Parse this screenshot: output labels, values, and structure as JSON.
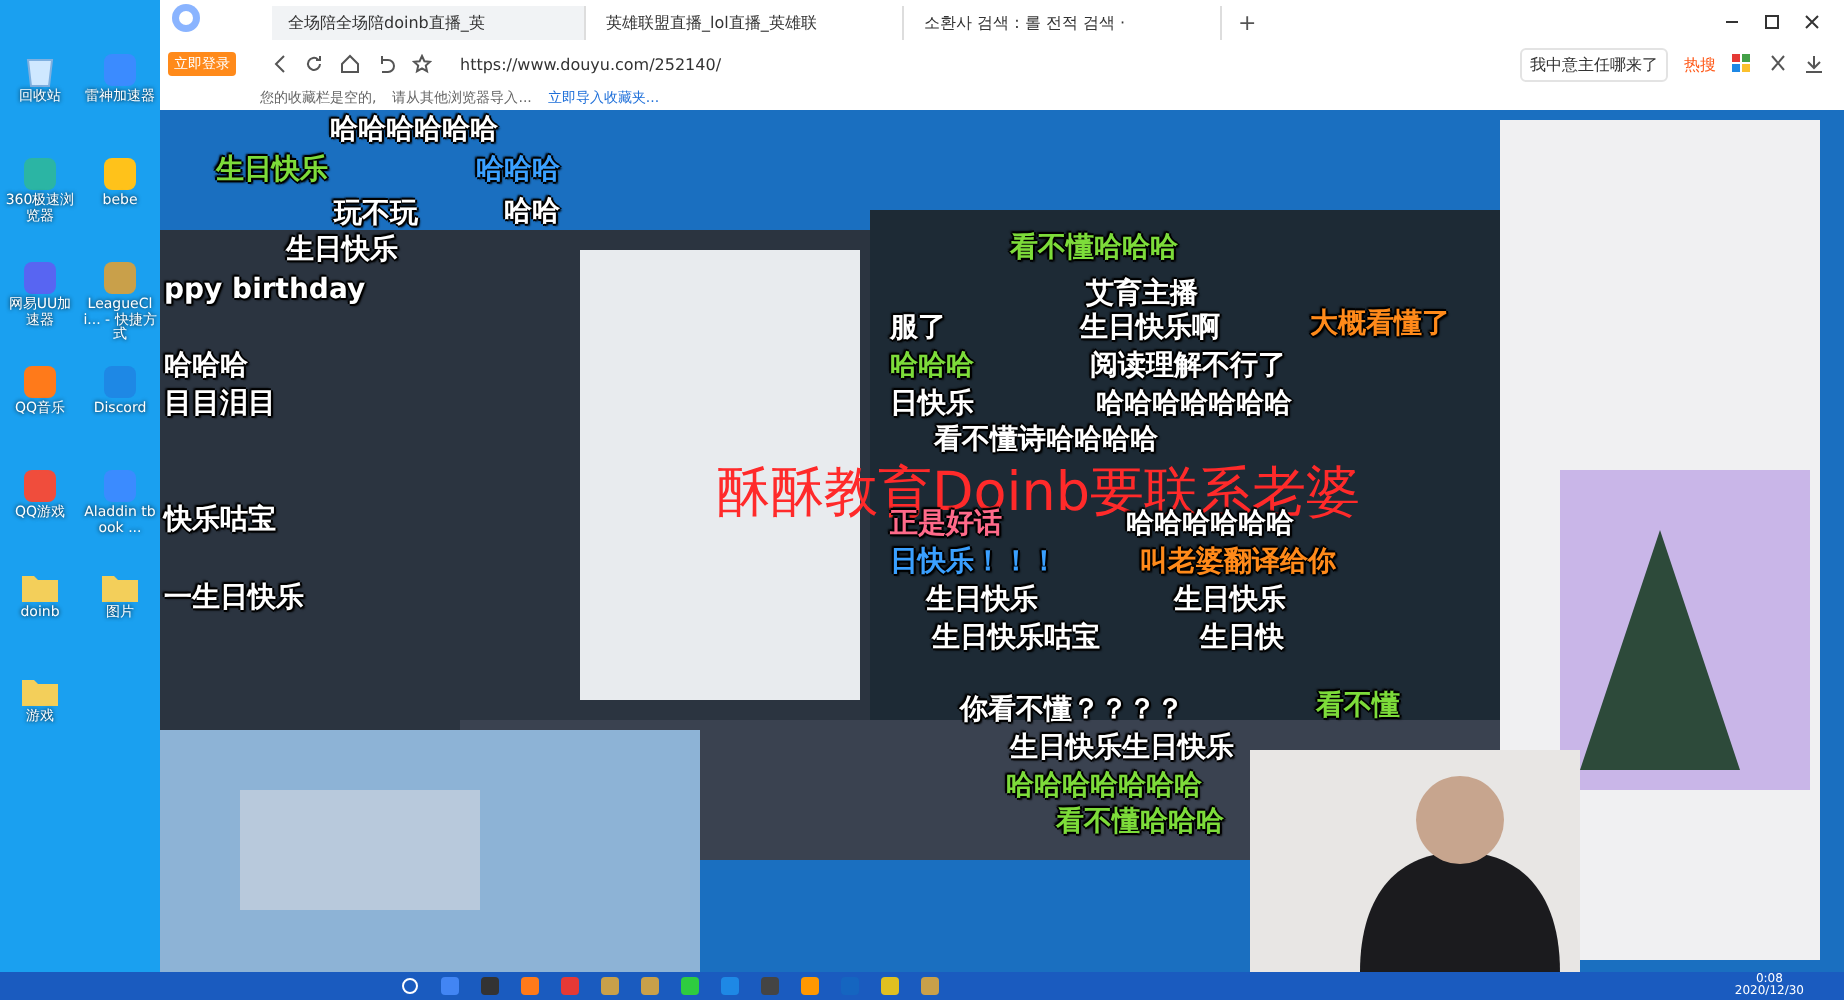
{
  "desktop": {
    "icons": [
      {
        "label": "回收站",
        "kind": "trash"
      },
      {
        "label": "雷神加速器",
        "kind": "app"
      },
      {
        "label": "360极速浏览器",
        "kind": "app"
      },
      {
        "label": "bebe",
        "kind": "app"
      },
      {
        "label": "网易UU加速器",
        "kind": "app"
      },
      {
        "label": "LeagueCli... - 快捷方式",
        "kind": "app"
      },
      {
        "label": "QQ音乐",
        "kind": "app"
      },
      {
        "label": "Discord",
        "kind": "app"
      },
      {
        "label": "QQ游戏",
        "kind": "app"
      },
      {
        "label": "Aladdin tbook ...",
        "kind": "app"
      },
      {
        "label": "doinb",
        "kind": "folder"
      },
      {
        "label": "图片",
        "kind": "folder"
      },
      {
        "label": "游戏",
        "kind": "folder"
      }
    ]
  },
  "browser": {
    "login_badge": "立即登录",
    "tabs": [
      {
        "title": "全场陪全场陪doinb直播_英",
        "selected": true
      },
      {
        "title": "英雄联盟直播_lol直播_英雄联",
        "selected": false
      },
      {
        "title": "소환사 검색 : 롤 전적 검색 ·",
        "selected": false
      }
    ],
    "new_tab": "+",
    "url": "https://www.douyu.com/252140/",
    "search": {
      "value": "我中意主任哪来了",
      "hot": "热搜"
    },
    "bookmarks_bar": {
      "message": "您的收藏栏是空的,",
      "hint": "请从其他浏览器导入...",
      "link": "立即导入收藏夹..."
    }
  },
  "player": {
    "kind": "picture",
    "danmaku": [
      {
        "text": "哈哈哈哈哈哈",
        "color": "#ffffff"
      },
      {
        "text": "生日快乐",
        "color": "#7ddc3a"
      },
      {
        "text": "哈哈哈",
        "color": "#3aa0ff"
      },
      {
        "text": "玩不玩",
        "color": "#ffffff"
      },
      {
        "text": "哈哈",
        "color": "#ffffff"
      },
      {
        "text": "生日快乐",
        "color": "#ffffff"
      },
      {
        "text": "看不懂哈哈哈",
        "color": "#7ddc3a"
      },
      {
        "text": "ppy birthday",
        "color": "#ffffff"
      },
      {
        "text": "艾育主播",
        "color": "#ffffff"
      },
      {
        "text": "服了",
        "color": "#ffffff"
      },
      {
        "text": "生日快乐啊",
        "color": "#ffffff"
      },
      {
        "text": "大概看懂了",
        "color": "#ff8a1a"
      },
      {
        "text": "哈哈哈",
        "color": "#ffffff"
      },
      {
        "text": "哈哈哈",
        "color": "#7ddc3a"
      },
      {
        "text": "阅读理解不行了",
        "color": "#ffffff"
      },
      {
        "text": "目目泪目",
        "color": "#ffffff"
      },
      {
        "text": "日快乐",
        "color": "#ffffff"
      },
      {
        "text": "哈哈哈哈哈哈哈",
        "color": "#ffffff"
      },
      {
        "text": "看不懂诗哈哈哈哈",
        "color": "#ffffff"
      },
      {
        "text": "酥酥教育Doinb要联系老婆",
        "color": "#ff2a2a"
      },
      {
        "text": "快乐咕宝",
        "color": "#ffffff"
      },
      {
        "text": "正是好话",
        "color": "#ff6a8a"
      },
      {
        "text": "哈哈哈哈哈哈",
        "color": "#ffffff"
      },
      {
        "text": "日快乐！！！",
        "color": "#3aa0ff"
      },
      {
        "text": "叫老婆翻译给你",
        "color": "#ff8a1a"
      },
      {
        "text": "一生日快乐",
        "color": "#ffffff"
      },
      {
        "text": "生日快乐",
        "color": "#ffffff"
      },
      {
        "text": "生日快乐",
        "color": "#ffffff"
      },
      {
        "text": "生日快乐咕宝",
        "color": "#ffffff"
      },
      {
        "text": "生日快",
        "color": "#ffffff"
      },
      {
        "text": "你看不懂？？？？",
        "color": "#ffffff"
      },
      {
        "text": "看不懂",
        "color": "#7ddc3a"
      },
      {
        "text": "生日快乐生日快乐",
        "color": "#ffffff"
      },
      {
        "text": "哈哈哈哈哈哈哈",
        "color": "#7ddc3a"
      },
      {
        "text": "看不懂哈哈哈",
        "color": "#7ddc3a"
      }
    ]
  },
  "taskbar": {
    "time": "0:08",
    "date": "2020/12/30"
  }
}
